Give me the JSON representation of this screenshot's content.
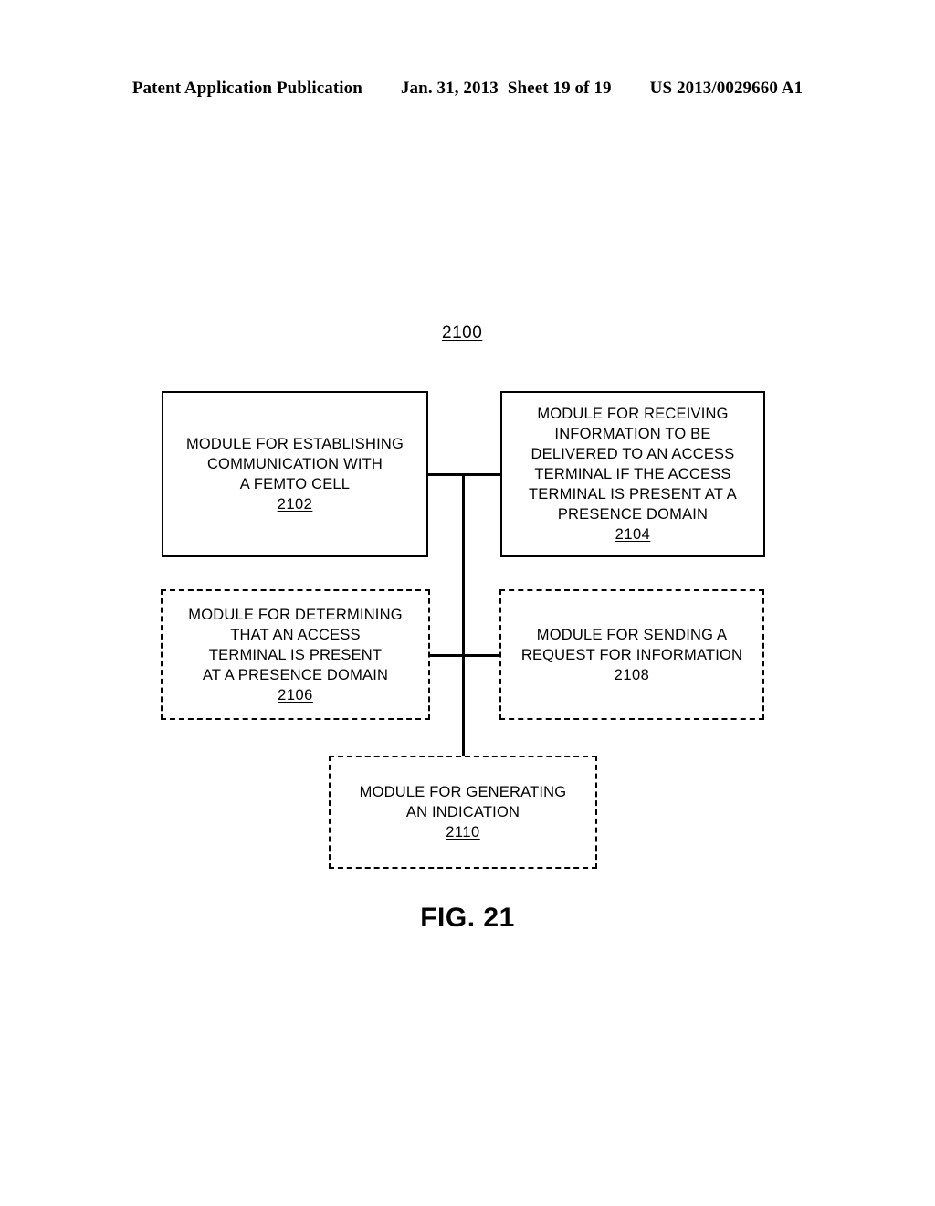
{
  "header": {
    "publication": "Patent Application Publication",
    "date": "Jan. 31, 2013",
    "sheet": "Sheet 19 of 19",
    "document_number": "US 2013/0029660 A1"
  },
  "figure": {
    "caption": "FIG. 21",
    "diagram_ref": "2100",
    "boxes": [
      {
        "id": "2102",
        "border": "solid",
        "lines": [
          "MODULE FOR ESTABLISHING",
          "COMMUNICATION WITH",
          "A FEMTO CELL"
        ],
        "ref": "2102"
      },
      {
        "id": "2104",
        "border": "solid",
        "lines": [
          "MODULE FOR RECEIVING",
          "INFORMATION TO BE",
          "DELIVERED TO AN ACCESS",
          "TERMINAL IF THE ACCESS",
          "TERMINAL IS PRESENT AT A",
          "PRESENCE DOMAIN"
        ],
        "ref": "2104"
      },
      {
        "id": "2106",
        "border": "dashed",
        "lines": [
          "MODULE FOR DETERMINING",
          "THAT AN ACCESS",
          "TERMINAL IS PRESENT",
          "AT A PRESENCE DOMAIN"
        ],
        "ref": "2106"
      },
      {
        "id": "2108",
        "border": "dashed",
        "lines": [
          "MODULE FOR SENDING A",
          "REQUEST FOR INFORMATION"
        ],
        "ref": "2108"
      },
      {
        "id": "2110",
        "border": "dashed",
        "lines": [
          "MODULE FOR GENERATING",
          "AN INDICATION"
        ],
        "ref": "2110"
      }
    ]
  },
  "colors": {
    "ink": "#000000",
    "page": "#ffffff"
  }
}
